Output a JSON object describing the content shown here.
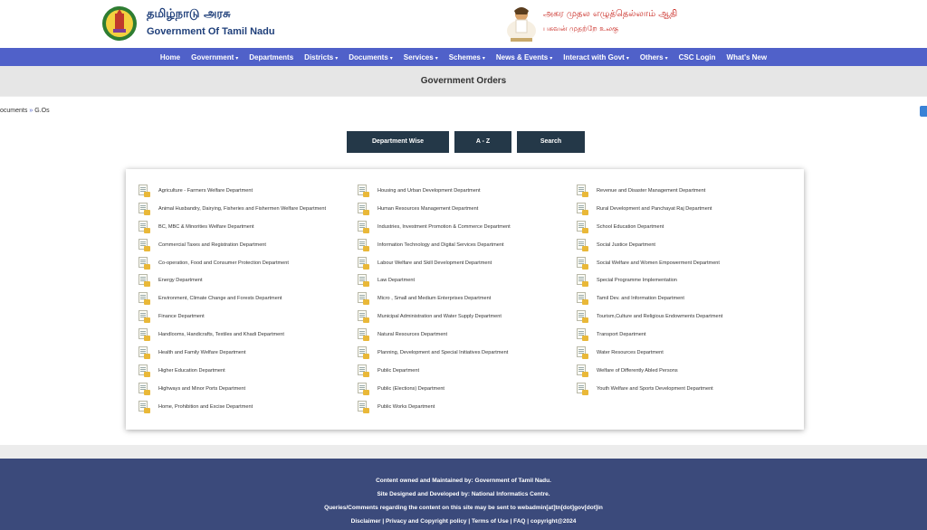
{
  "header": {
    "tamil_title": "தமிழ்நாடு அரசு",
    "english_title": "Government Of Tamil Nadu",
    "quote_line1": "அகர முதல எழுத்தெல்லாம் ஆதி",
    "quote_line2": "பகவன் முதற்றே உலகு"
  },
  "nav": [
    {
      "label": "Home",
      "dropdown": false
    },
    {
      "label": "Government",
      "dropdown": true
    },
    {
      "label": "Departments",
      "dropdown": false
    },
    {
      "label": "Districts",
      "dropdown": true
    },
    {
      "label": "Documents",
      "dropdown": true
    },
    {
      "label": "Services",
      "dropdown": true
    },
    {
      "label": "Schemes",
      "dropdown": true
    },
    {
      "label": "News & Events",
      "dropdown": true
    },
    {
      "label": "Interact with Govt",
      "dropdown": true
    },
    {
      "label": "Others",
      "dropdown": true
    },
    {
      "label": "CSC Login",
      "dropdown": false
    },
    {
      "label": "What's New",
      "dropdown": false
    }
  ],
  "page_title": "Government Orders",
  "breadcrumb": {
    "parent": "ocuments",
    "separator": "»",
    "current": "G.Os"
  },
  "buttons": {
    "department_wise": "Department Wise",
    "a_z": "A - Z",
    "search": "Search"
  },
  "departments": {
    "col1": [
      "Agriculture - Farmers Welfare Department",
      "Animal Husbandry, Dairying, Fisheries and Fishermen Welfare Department",
      "BC, MBC & Minorities Welfare Department",
      "Commercial Taxes and Registration Department",
      "Co-operation, Food and Consumer Protection Department",
      "Energy Department",
      "Environment, Climate Change and Forests Department",
      "Finance Department",
      "Handlooms, Handicrafts, Textiles and Khadi Department",
      "Health and Family Welfare Department",
      "Higher Education Department",
      "Highways and Minor Ports Department",
      "Home, Prohibition and Excise Department"
    ],
    "col2": [
      "Housing and Urban Development Department",
      "Human Resources Management Department",
      "Industries, Investment Promotion & Commerce Department",
      "Information Technology and Digital Services Department",
      "Labour Welfare and Skill Development Department",
      "Law Department",
      "Micro , Small and Medium Enterprises Department",
      "Municipal Administration and Water Supply Department",
      "Natural Resources Department",
      "Planning, Development and Special Initiatives Department",
      "Public Department",
      "Public (Elections) Department",
      "Public Works Department"
    ],
    "col3": [
      "Revenue and Disaster Management Department",
      "Rural Development and Panchayat Raj Department",
      "School Education Department",
      "Social Justice Department",
      "Social Welfare and Women Empowerment Department",
      "Special Programme Implementation",
      "Tamil Dev. and Information Department",
      "Tourism,Culture and Religious Endowments Department",
      "Transport Department",
      "Water Resources Department",
      "Welfare of Differently Abled Persons",
      "Youth Welfare and Sports Development Department"
    ]
  },
  "footer": {
    "line1": "Content owned and Maintained by: Government of Tamil Nadu.",
    "line2": "Site Designed and Developed by: National Informatics Centre.",
    "line3": "Queries/Comments regarding the content on this site may be sent to webadmin[at]tn[dot]gov[dot]in",
    "links": [
      "Disclaimer",
      "Privacy and Copyright policy",
      "Terms of Use",
      "FAQ",
      "copyright@2024"
    ]
  },
  "colors": {
    "nav_bg": "#5061c9",
    "button_bg": "#243848",
    "footer_bg": "#3b4a7b",
    "brand_text": "#1f3f7a",
    "quote_text": "#c8251e"
  }
}
